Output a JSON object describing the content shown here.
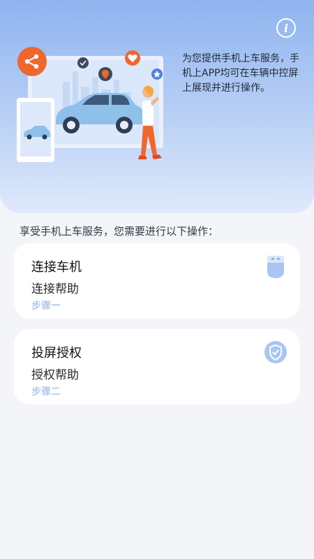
{
  "hero": {
    "description": "为您提供手机上车服务，手机上APP均可在车辆中控屏上展现并进行操作。",
    "info_icon": "info-icon"
  },
  "section": {
    "title": "享受手机上车服务，您需要进行以下操作："
  },
  "cards": [
    {
      "title": "连接车机",
      "help": "连接帮助",
      "step": "步骤一",
      "icon": "usb-icon"
    },
    {
      "title": "投屏授权",
      "help": "授权帮助",
      "step": "步骤二",
      "icon": "shield-check-icon"
    }
  ],
  "colors": {
    "accent": "#8fb1e3",
    "hero_top": "#8fb4ef",
    "background": "#f4f5f9",
    "share_orange": "#f0662f"
  }
}
